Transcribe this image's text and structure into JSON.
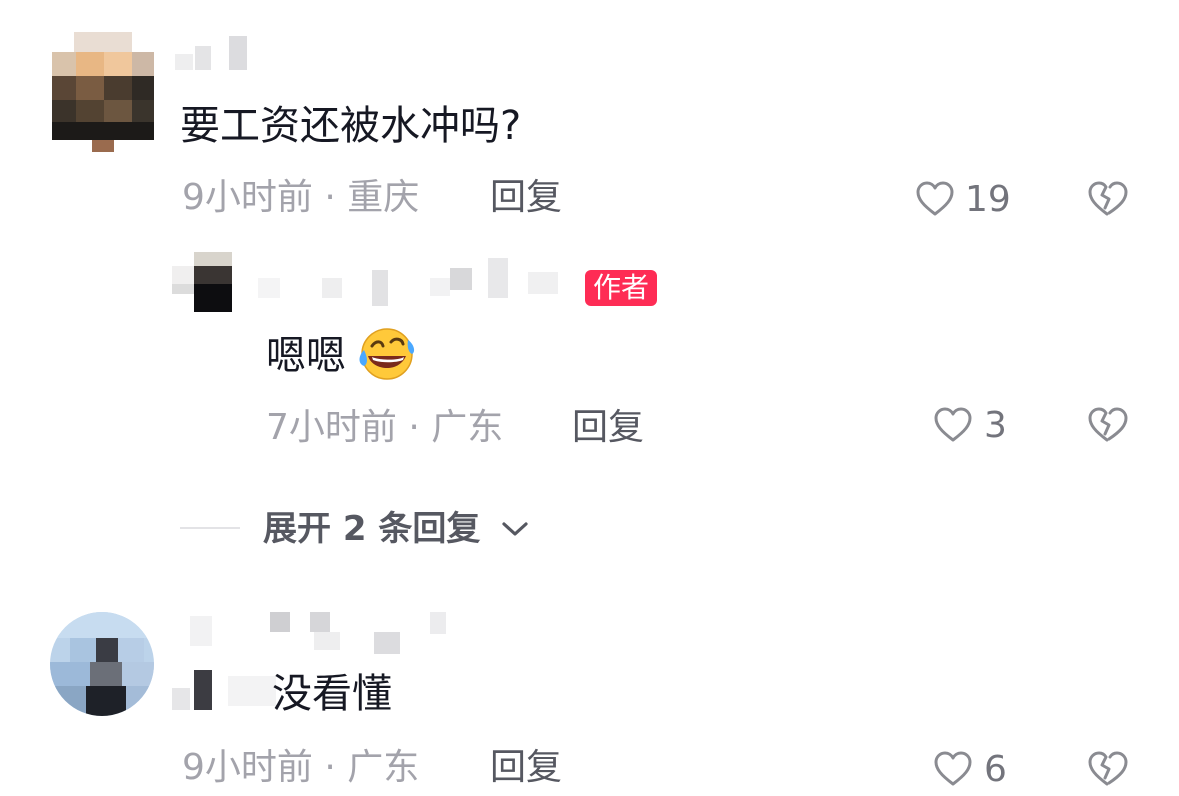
{
  "comments": [
    {
      "text": "要工资还被水冲吗?",
      "time_location": "9小时前 · 重庆",
      "reply_label": "回复",
      "likes": "19",
      "replies": [
        {
          "badge": "作者",
          "text": "嗯嗯",
          "emoji": "🤣",
          "time_location": "7小时前 · 广东",
          "reply_label": "回复",
          "likes": "3"
        }
      ],
      "expand_label": "展开 2 条回复"
    },
    {
      "text": "没看懂",
      "time_location": "9小时前 · 广东",
      "reply_label": "回复",
      "likes": "6"
    }
  ],
  "icons": {
    "like": "heart-outline-icon",
    "dislike": "broken-heart-icon",
    "expand": "chevron-down-icon"
  }
}
